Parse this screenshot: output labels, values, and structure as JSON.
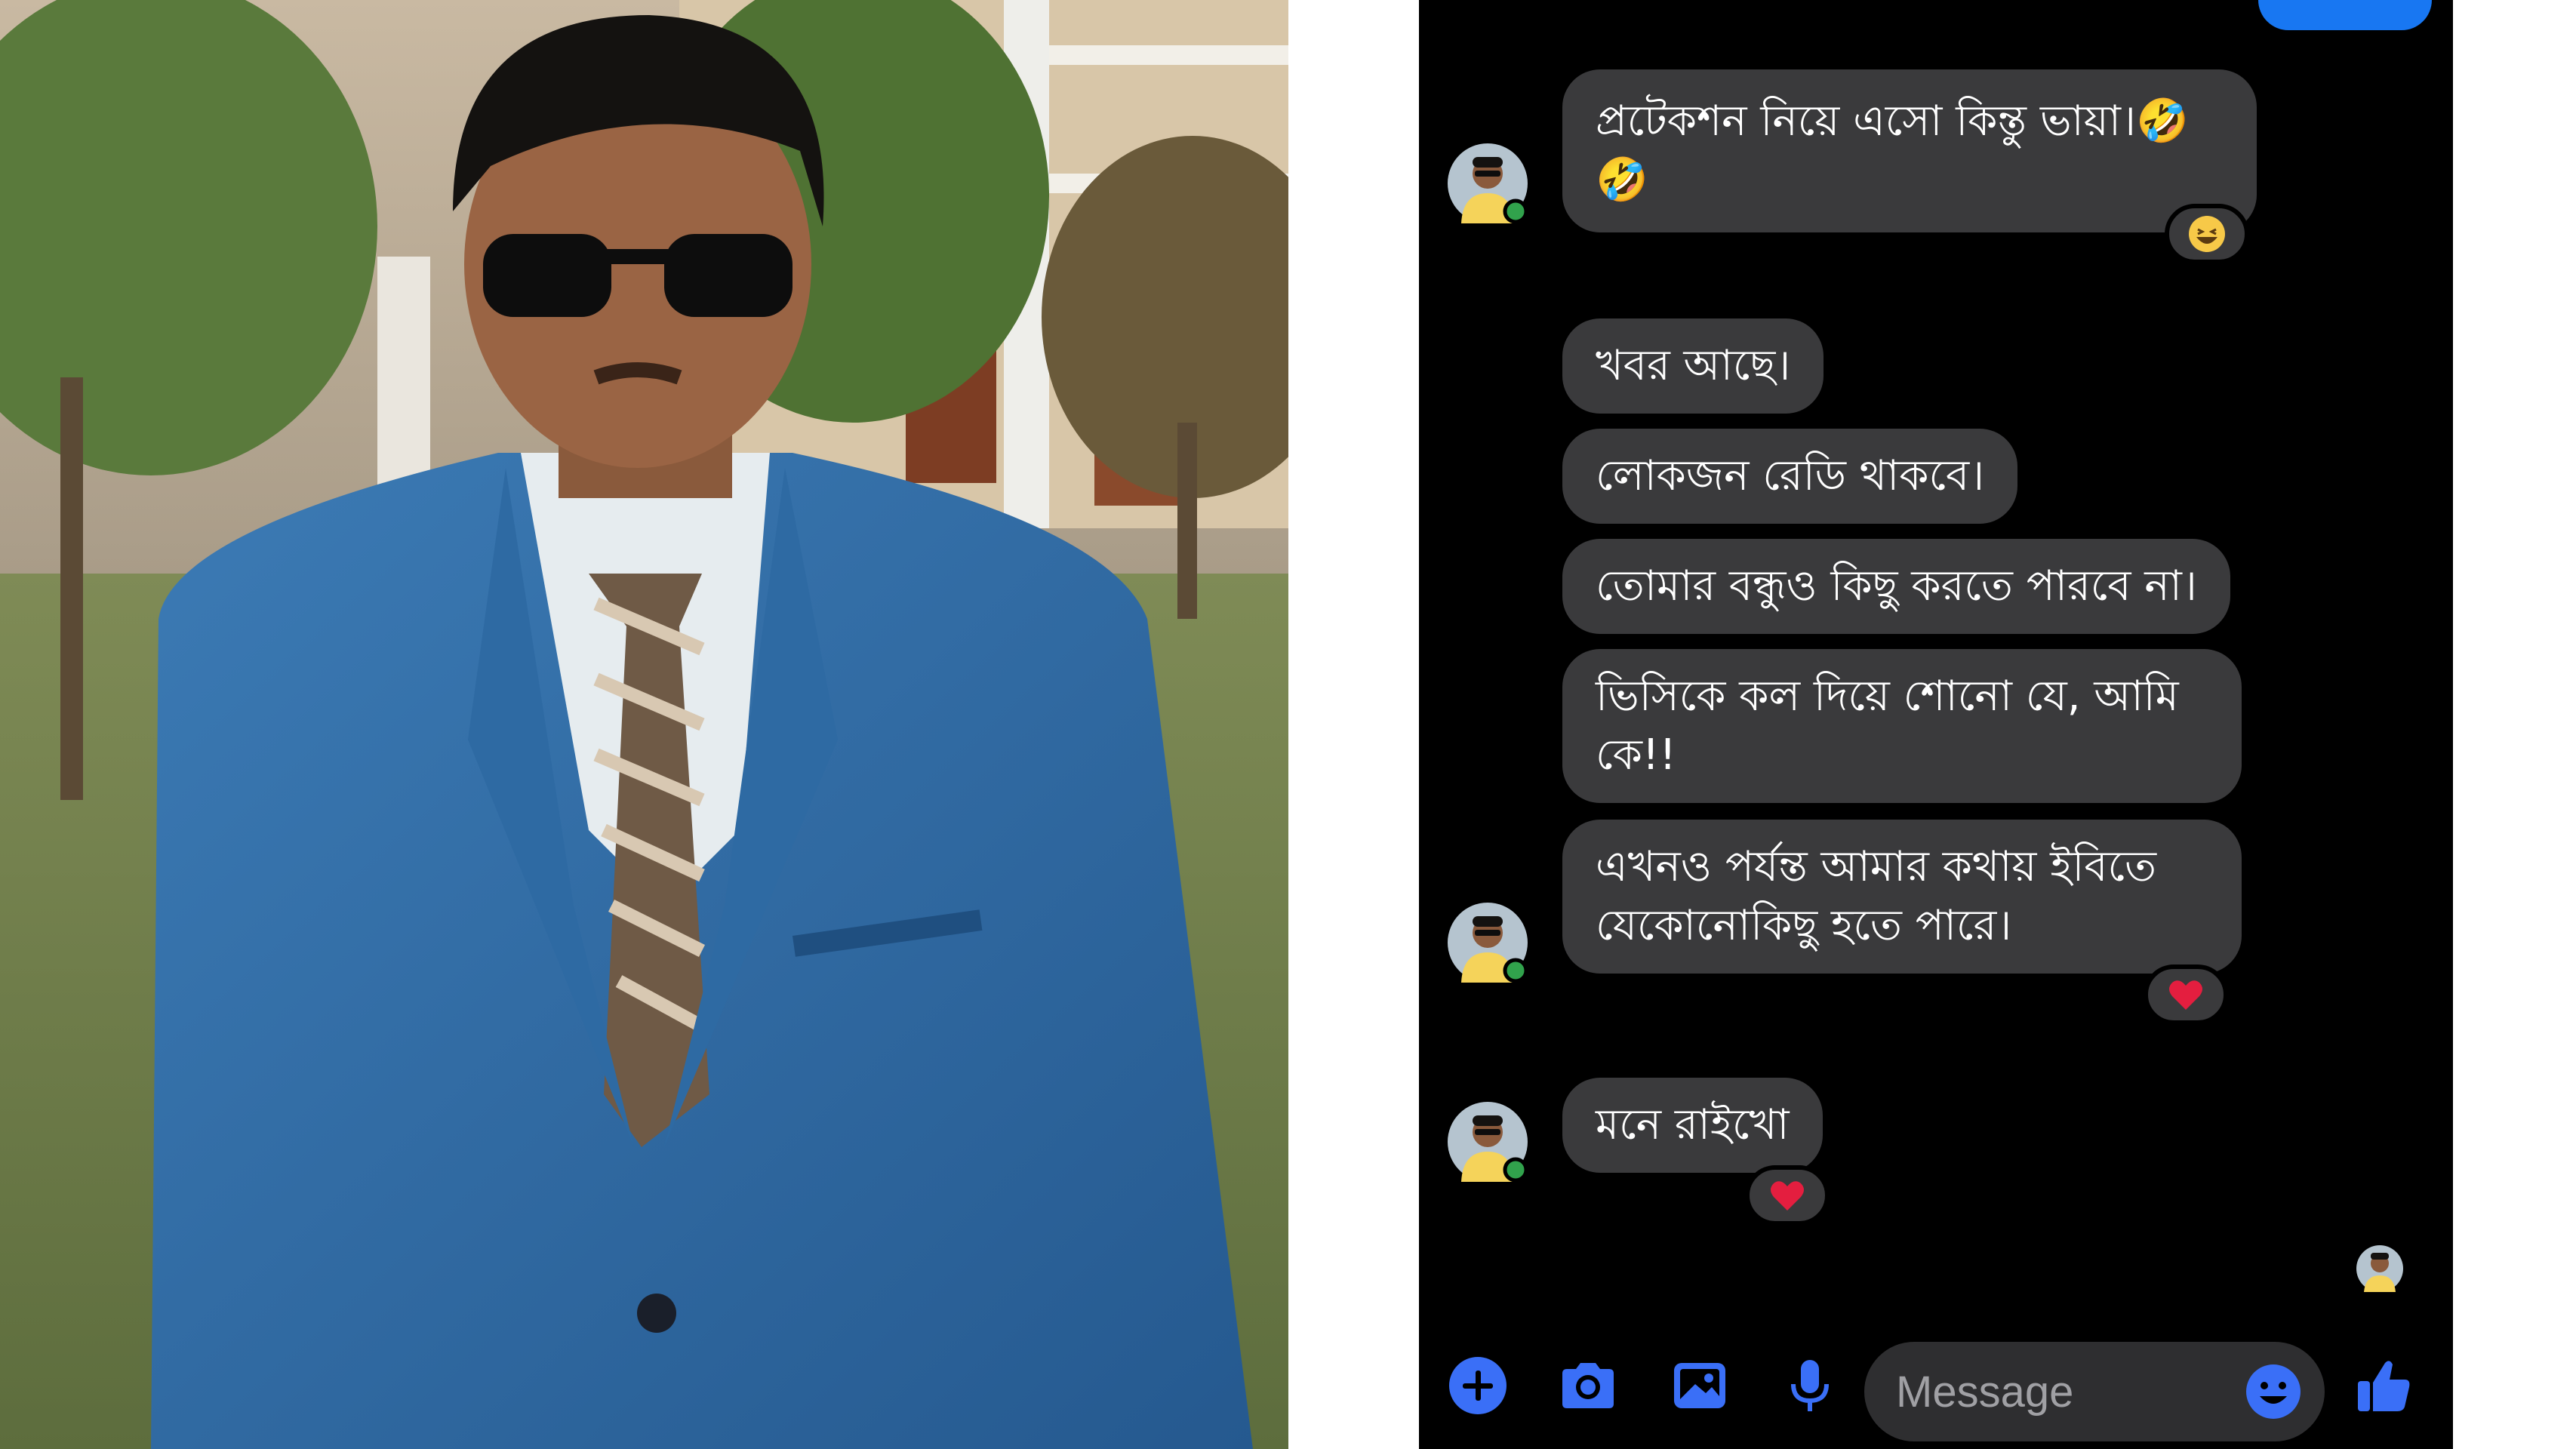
{
  "colors": {
    "accent": "#3a6ff7",
    "bubble": "#3a3a3c",
    "background": "#000000",
    "online": "#31a24c",
    "heart": "#e41e3f"
  },
  "messages": [
    {
      "text": "প্রটেকশন নিয়ে এসো কিন্তু ভায়া।🤣🤣",
      "reaction": "laughing-emoji",
      "avatar": true
    },
    {
      "text": "খবর আছে।"
    },
    {
      "text": "লোকজন রেডি থাকবে।"
    },
    {
      "text": "তোমার বন্ধুও কিছু করতে পারবে না।"
    },
    {
      "text": "ভিসিকে কল দিয়ে শোনো যে, আমি কে!!"
    },
    {
      "text": "এখনও পর্যন্ত আমার কথায় ইবিতে যেকোনোকিছু হতে পারে।",
      "reaction": "heart-emoji",
      "avatar": true
    },
    {
      "text": "মনে রাইখো",
      "reaction": "heart-emoji",
      "avatar": true
    }
  ],
  "composer": {
    "placeholder": "Message",
    "icons": [
      "plus-icon",
      "camera-icon",
      "gallery-icon",
      "microphone-icon",
      "emoji-icon",
      "thumbs-up-icon"
    ]
  }
}
